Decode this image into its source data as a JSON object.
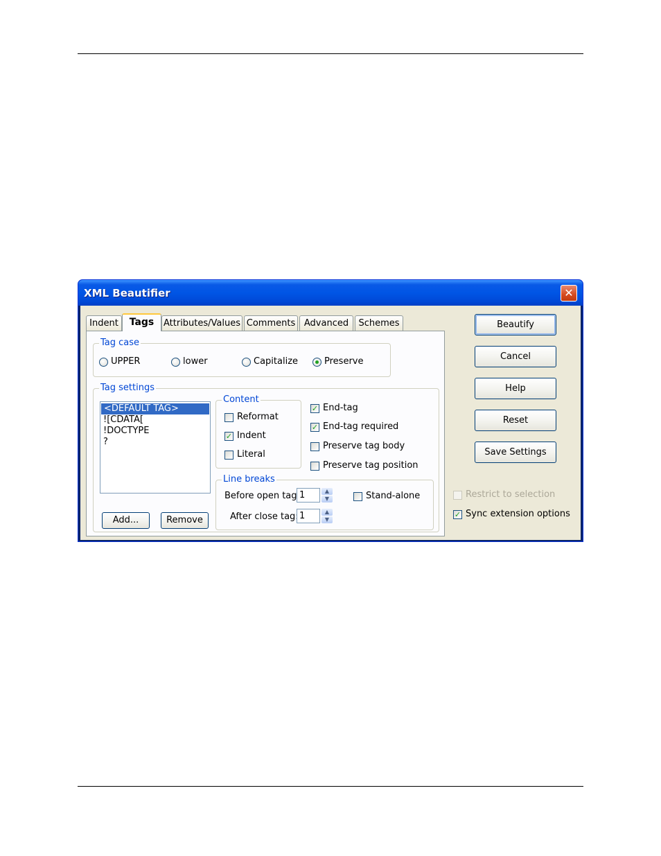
{
  "window": {
    "title": "XML Beautifier",
    "close_glyph": "✕"
  },
  "tabs": [
    {
      "label": "Indent",
      "active": false
    },
    {
      "label": "Tags",
      "active": true
    },
    {
      "label": "Attributes/Values",
      "active": false
    },
    {
      "label": "Comments",
      "active": false
    },
    {
      "label": "Advanced",
      "active": false
    },
    {
      "label": "Schemes",
      "active": false
    }
  ],
  "tag_case": {
    "legend": "Tag case",
    "options": [
      {
        "label": "UPPER",
        "selected": false
      },
      {
        "label": "lower",
        "selected": false
      },
      {
        "label": "Capitalize",
        "selected": false
      },
      {
        "label": "Preserve",
        "selected": true
      }
    ]
  },
  "tag_settings": {
    "legend": "Tag settings",
    "list_items": [
      "<DEFAULT TAG>",
      "![CDATA[",
      "!DOCTYPE",
      "?"
    ],
    "selected_index": 0,
    "add_label": "Add...",
    "remove_label": "Remove",
    "content": {
      "legend": "Content",
      "reformat": {
        "label": "Reformat",
        "checked": false
      },
      "indent": {
        "label": "Indent",
        "checked": true
      },
      "literal": {
        "label": "Literal",
        "checked": false
      }
    },
    "end_tag": {
      "label": "End-tag",
      "checked": true
    },
    "end_tag_required": {
      "label": "End-tag required",
      "checked": true
    },
    "preserve_body": {
      "label": "Preserve tag body",
      "checked": false
    },
    "preserve_position": {
      "label": "Preserve tag position",
      "checked": false
    },
    "line_breaks": {
      "legend": "Line breaks",
      "before_open_label": "Before open tag:",
      "before_open_value": "1",
      "after_close_label": "After close tag:",
      "after_close_value": "1",
      "stand_alone": {
        "label": "Stand-alone",
        "checked": false
      }
    }
  },
  "buttons": {
    "beautify": "Beautify",
    "cancel": "Cancel",
    "help": "Help",
    "reset": "Reset",
    "save_settings": "Save Settings"
  },
  "options": {
    "restrict_to_selection": {
      "label": "Restrict to selection",
      "checked": false,
      "disabled": true
    },
    "sync_extension_options": {
      "label": "Sync extension options",
      "checked": true
    }
  },
  "glyphs": {
    "check": "✓",
    "spin_up": "▲",
    "spin_down": "▼"
  }
}
